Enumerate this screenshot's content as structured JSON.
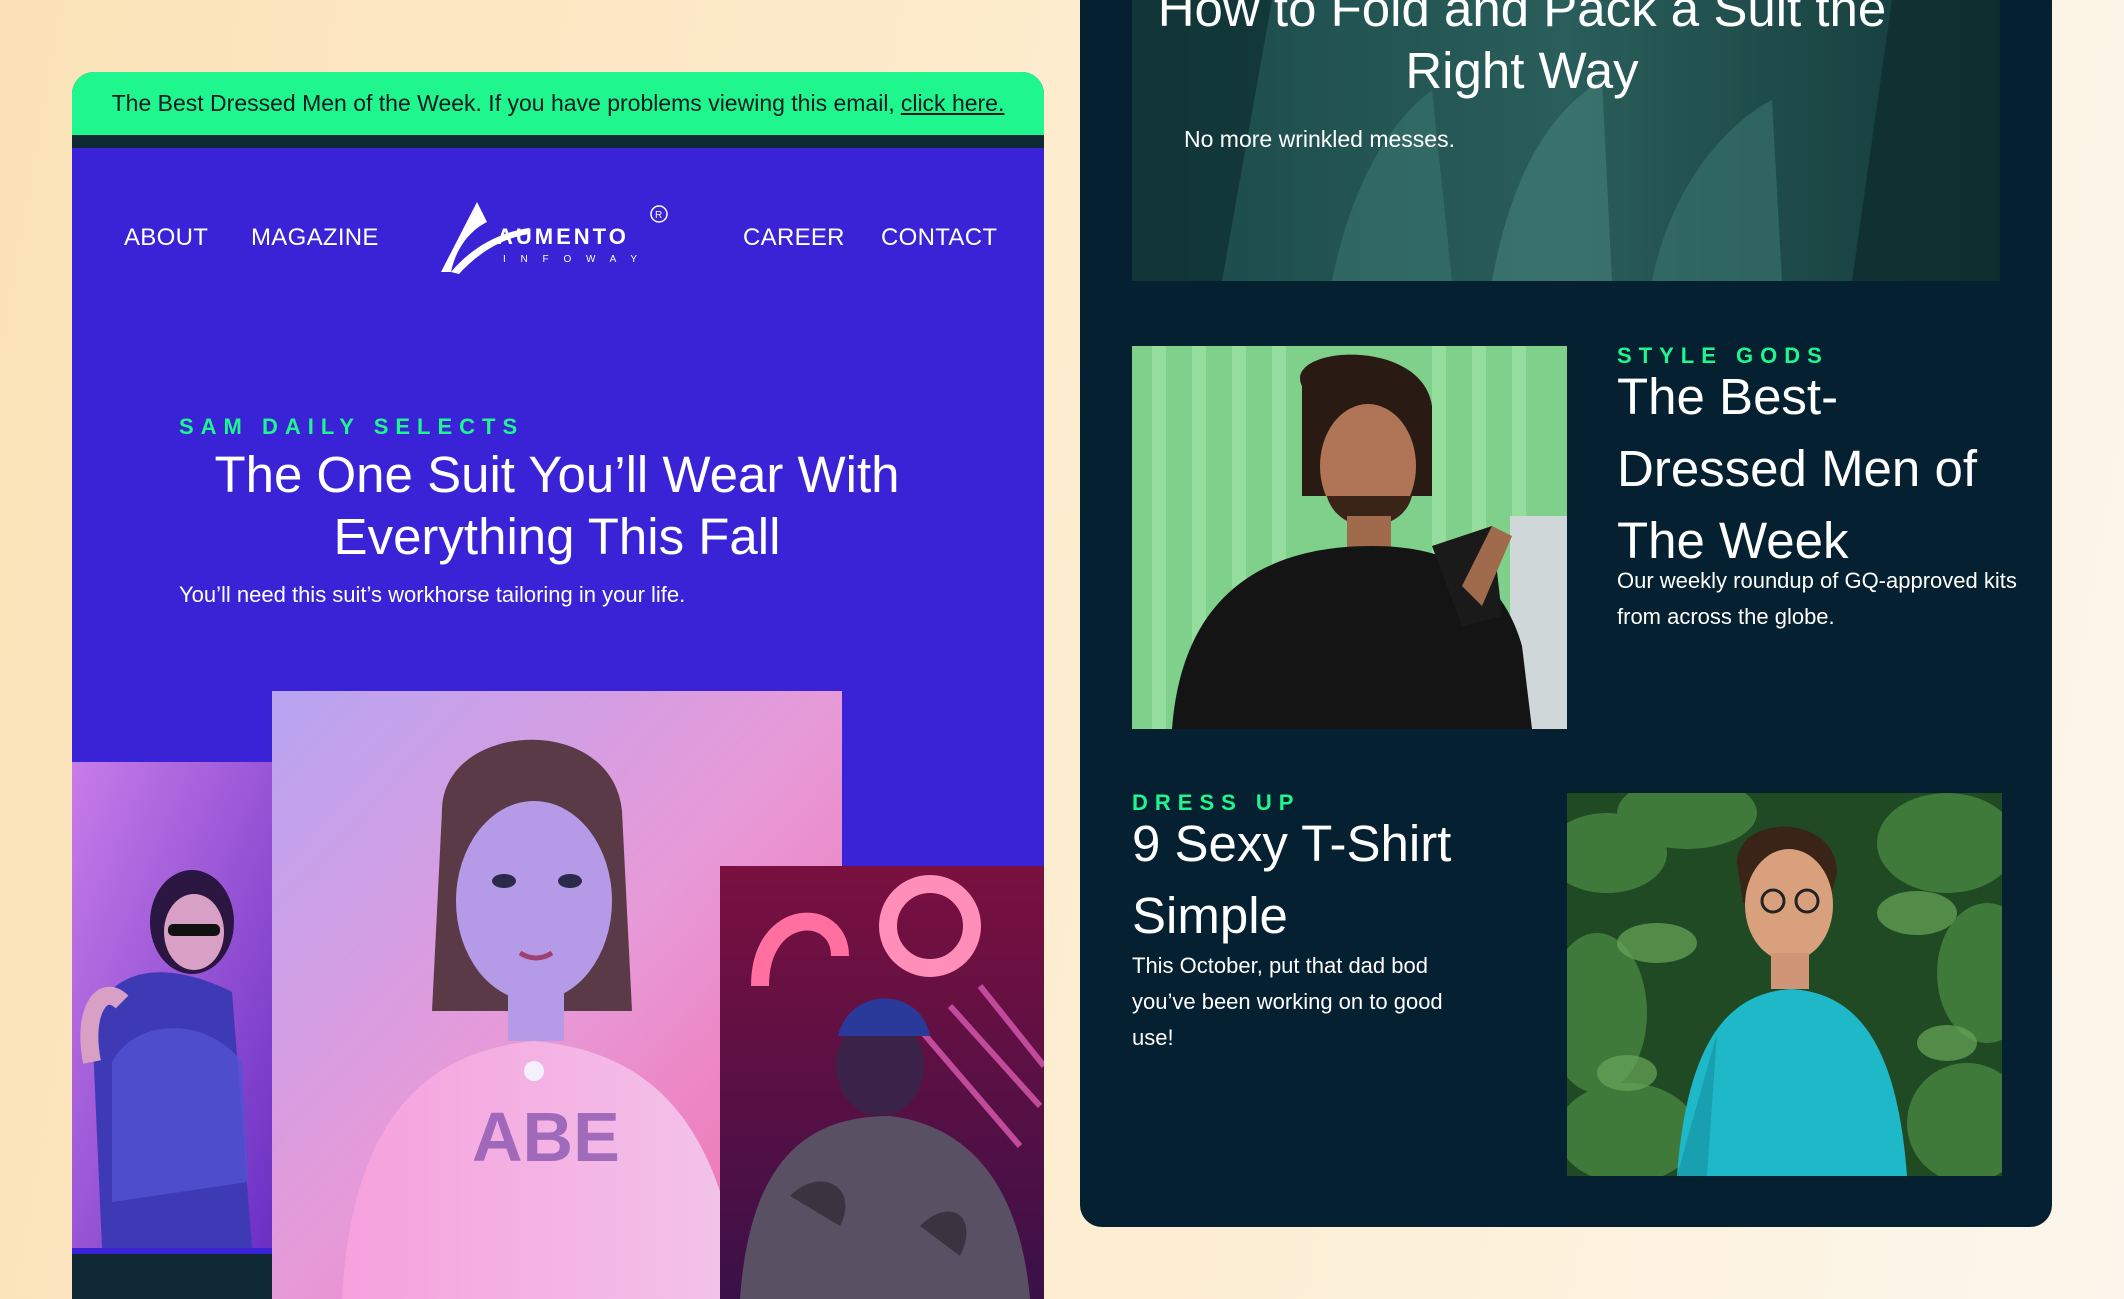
{
  "left_email": {
    "banner": {
      "text": "The Best Dressed Men of the Week. If you have problems viewing this email,",
      "link": "click here."
    },
    "nav": {
      "about": "ABOUT",
      "magazine": "MAGAZINE",
      "career": "CAREER",
      "contact": "CONTACT"
    },
    "logo": {
      "name": "AUMENTO",
      "sub": "I N F O W A Y",
      "registered": "R"
    },
    "hero": {
      "kicker": "SAM DAILY SELECTS",
      "title": "The One Suit You’ll Wear With Everything This Fall",
      "subtitle": "You’ll need this suit’s workhorse tailoring in your life."
    },
    "photos": {
      "left": "woman-sunglasses-denim-jacket",
      "center": "woman-neon-pink-shirt",
      "right": "man-neon-sign-camo-jacket"
    }
  },
  "right_email": {
    "top_feature": {
      "title": "How to Fold and Pack a Suit the Right Way",
      "subtitle": "No more wrinkled messes."
    },
    "article1": {
      "kicker": "STYLE GODS",
      "title": "The Best-Dressed Men of The Week",
      "desc": "Our weekly roundup of GQ-approved kits from across the globe.",
      "image": "man-dreadlocks-black-shirt"
    },
    "article2": {
      "kicker": "DRESS UP",
      "title": "9 Sexy T-Shirt Simple",
      "desc": "This October, put that dad bod you’ve been working on to good use!",
      "image": "man-glasses-teal-tshirt"
    }
  },
  "colors": {
    "accent_green": "#1ff78e",
    "email_purple": "#3a22d6",
    "dark_navy": "#052030",
    "white": "#ffffff"
  }
}
